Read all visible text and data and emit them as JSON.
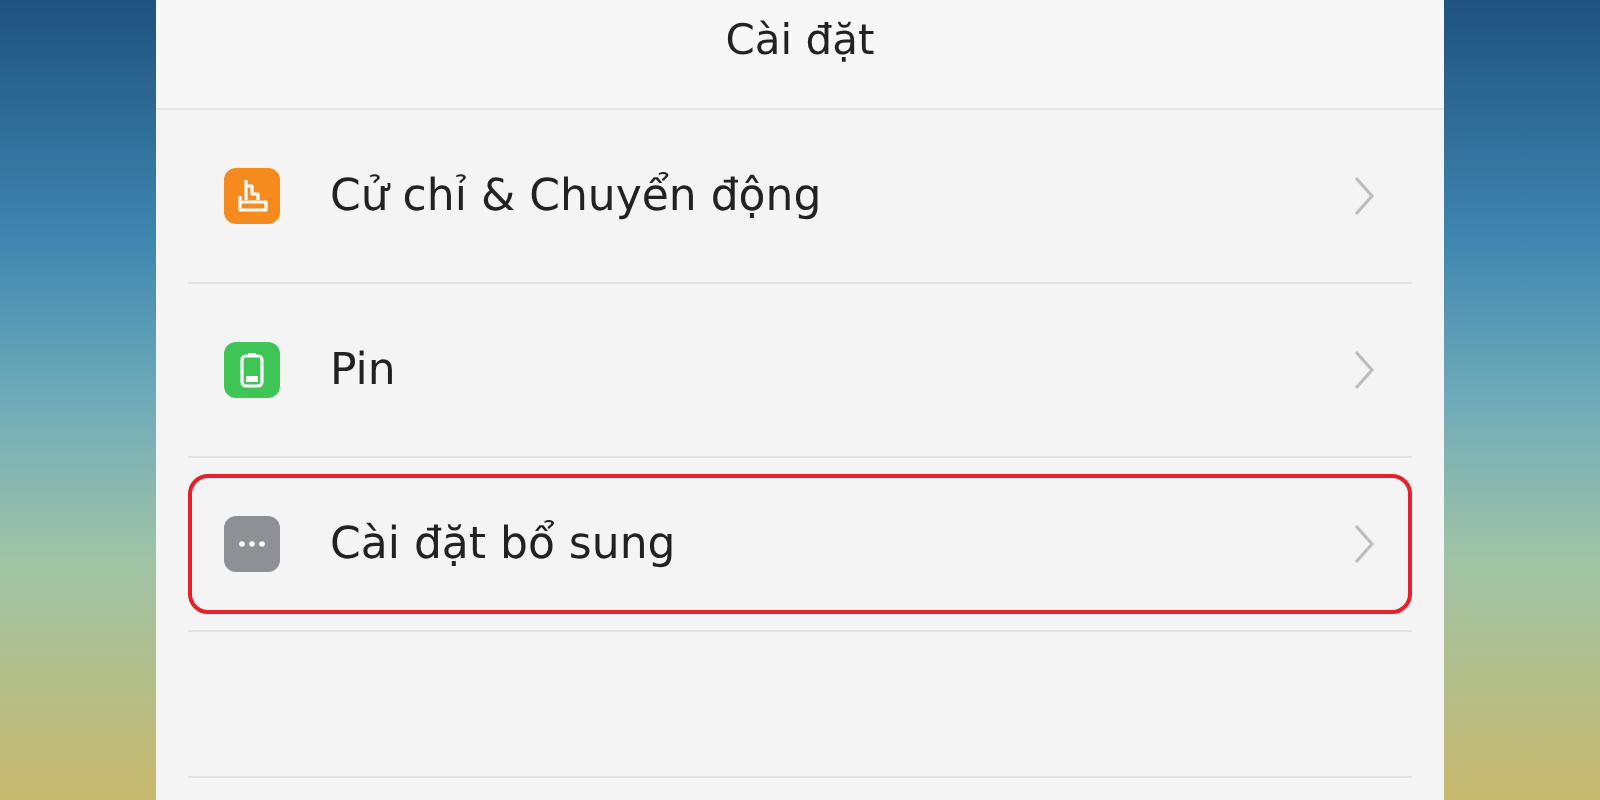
{
  "title": "Cài đặt",
  "items": [
    {
      "label": "Cử chỉ & Chuyển động",
      "kind": "gesture",
      "color": "#f58a1f",
      "highlighted": false
    },
    {
      "label": "Pin",
      "kind": "battery",
      "color": "#3fc456",
      "highlighted": false
    },
    {
      "label": "Cài đặt bổ sung",
      "kind": "more",
      "color": "#8e9096",
      "highlighted": true
    }
  ]
}
